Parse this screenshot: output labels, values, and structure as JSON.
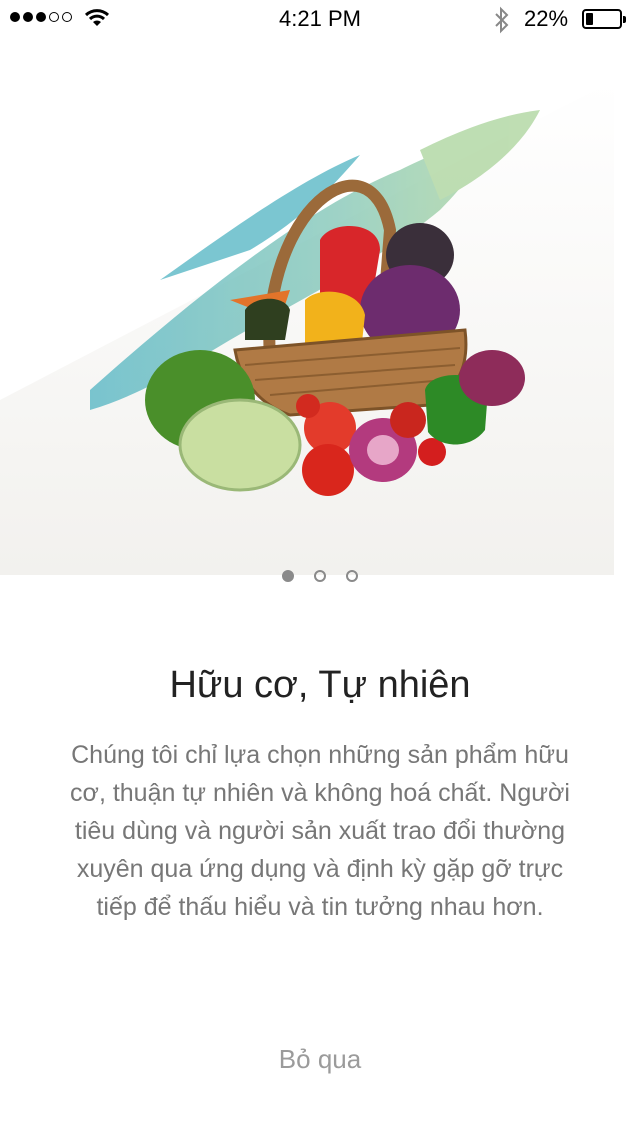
{
  "status_bar": {
    "signal_bars_filled": 3,
    "signal_bars_total": 5,
    "time": "4:21 PM",
    "battery_percent_label": "22%",
    "battery_level": 0.22
  },
  "hero": {
    "image_alt": "vegetable-basket",
    "icon": "vegetable-basket-illustration"
  },
  "pager": {
    "count": 3,
    "active_index": 0
  },
  "onboarding": {
    "title": "Hữu cơ, Tự nhiên",
    "description": "Chúng tôi chỉ lựa chọn những sản phẩm hữu cơ, thuận tự nhiên và không hoá chất. Người tiêu dùng và người sản xuất trao đổi thường xuyên qua ứng dụng và định kỳ gặp gỡ trực tiếp để thấu hiểu và tin tưởng nhau hơn.",
    "skip_label": "Bỏ qua"
  },
  "colors": {
    "title": "#222222",
    "body_text": "#777777",
    "skip": "#9b9b9b",
    "pager": "#8a8a8a",
    "brush_teal": "#4fb3c2",
    "brush_green": "#a9d39a"
  }
}
